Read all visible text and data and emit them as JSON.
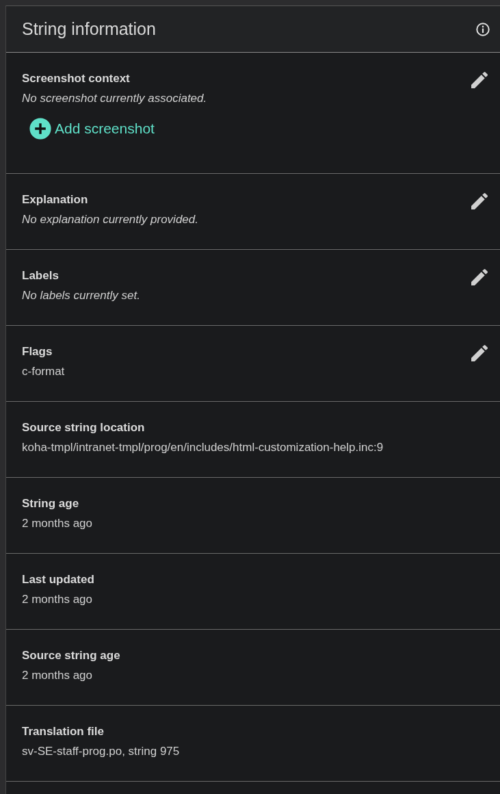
{
  "panel": {
    "title": "String information"
  },
  "sections": [
    {
      "title": "Screenshot context",
      "value": "No screenshot currently associated.",
      "kind": "empty",
      "editable": true,
      "action": "Add screenshot"
    },
    {
      "title": "Explanation",
      "value": "No explanation currently provided.",
      "kind": "empty",
      "editable": true
    },
    {
      "title": "Labels",
      "value": "No labels currently set.",
      "kind": "empty",
      "editable": true
    },
    {
      "title": "Flags",
      "value": "c-format",
      "kind": "value",
      "editable": true
    },
    {
      "title": "Source string location",
      "value": "koha-tmpl/intranet-tmpl/prog/en/includes/html-customization-help.inc:9",
      "kind": "value",
      "editable": false
    },
    {
      "title": "String age",
      "value": "2 months ago",
      "kind": "value",
      "editable": false
    },
    {
      "title": "Last updated",
      "value": "2 months ago",
      "kind": "value",
      "editable": false
    },
    {
      "title": "Source string age",
      "value": "2 months ago",
      "kind": "value",
      "editable": false
    },
    {
      "title": "Translation file",
      "value": "sv-SE-staff-prog.po, string 975",
      "kind": "value",
      "editable": false
    }
  ]
}
